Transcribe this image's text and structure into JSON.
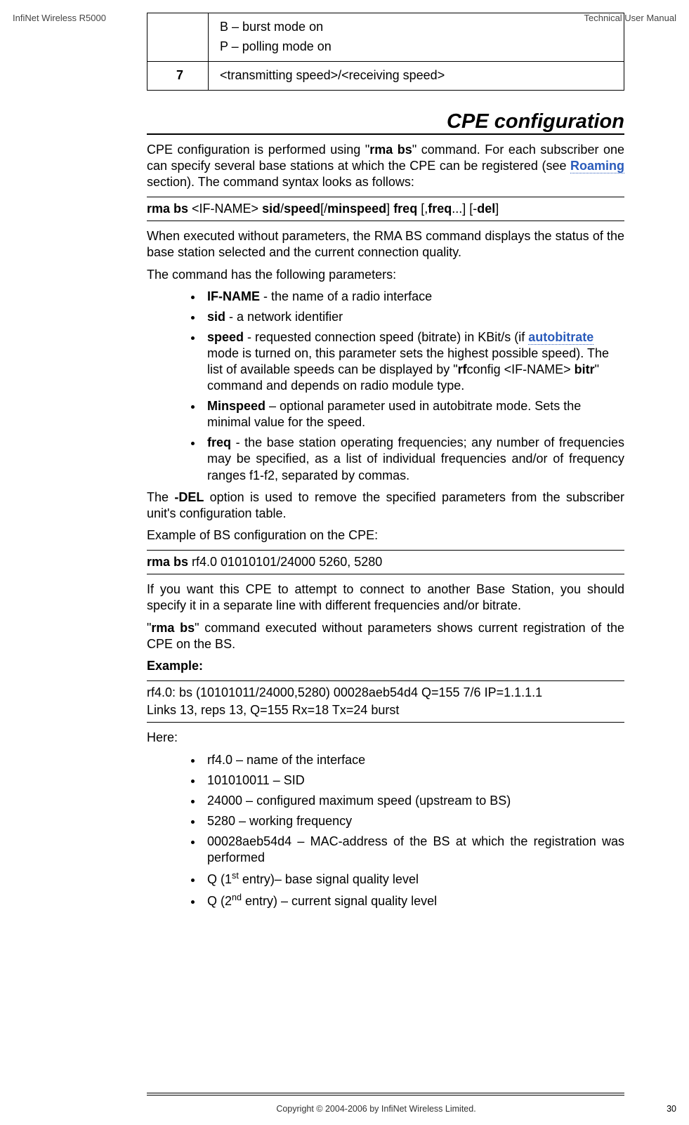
{
  "header": {
    "left": "InfiNet Wireless R5000",
    "right": "Technical User Manual"
  },
  "footer": {
    "copyright": "Copyright © 2004-2006 by InfiNet Wireless Limited.",
    "page": "30"
  },
  "table": {
    "row0_text1": "B – burst mode on",
    "row0_text2": "P – polling mode on",
    "row1_col0": "7",
    "row1_text": "<transmitting speed>/<receiving speed>"
  },
  "section_title": "CPE configuration",
  "p1a": "CPE configuration is performed using \"",
  "p1b": "rma bs",
  "p1c": "\" command. For each subscriber one can specify several base stations at which the CPE can be registered (see ",
  "p1d": "Roaming",
  "p1e": " section). The command syntax looks as follows:",
  "cmd1": {
    "a": "rma bs ",
    "b": "<IF-NAME> ",
    "c": "sid",
    "d": "/",
    "e": "speed",
    "f": "[/",
    "g": "minspeed",
    "h": "] ",
    "i": "freq ",
    "j": "[,",
    "k": "freq",
    "l": "...] [-",
    "m": "del",
    "n": "]"
  },
  "p2": "When executed without parameters, the RMA BS command displays the status of the base station selected and the current connection quality.",
  "p3": "The command has the following parameters:",
  "bullets1": {
    "b1a": "IF-NAME",
    "b1b": " - the name of a radio interface",
    "b2a": "sid",
    "b2b": " - a network identifier",
    "b3a": "speed",
    "b3b": " - requested connection speed (bitrate) in KBit/s (if ",
    "b3c": "autobitrate",
    "b3d": " mode is turned on, this parameter sets the highest possible speed). The list of available speeds can be displayed by \"",
    "b3e": "rf",
    "b3f": "config <IF-NAME> ",
    "b3g": "bitr",
    "b3h": "\" command and depends on radio module type.",
    "b4a": "Minspeed",
    "b4b": " – optional parameter used in autobitrate mode. Sets the minimal value for the speed.",
    "b5a": "freq",
    "b5b": " - the base station operating frequencies; any number of frequencies may be specified, as a list of individual frequencies and/or of frequency ranges f1-f2, separated by commas."
  },
  "p4a": "The ",
  "p4b": "-DEL",
  "p4c": " option is used to remove the specified parameters from the subscriber unit's configuration table.",
  "p5": "Example of BS configuration on the CPE:",
  "cmd2a": "rma bs ",
  "cmd2b": "rf4.0 01010101/24000 5260, 5280",
  "p6": "If you want this CPE to attempt to connect to another Base Station, you should specify it in a separate line with different frequencies and/or bitrate.",
  "p7a": "\"",
  "p7b": "rma bs",
  "p7c": "\" command executed without parameters shows current registration of the CPE on the BS.",
  "p8": "Example:",
  "cmd3_line1": "rf4.0: bs (10101011/24000,5280) 00028aeb54d4   Q=155  7/6  IP=1.1.1.1",
  "cmd3_line2": "Links 13, reps 13, Q=155 Rx=18 Tx=24  burst",
  "p9": "Here:",
  "bullets2": {
    "i1": "rf4.0 – name of the interface",
    "i2": "101010011 – SID",
    "i3": "24000 – configured maximum speed (upstream to BS)",
    "i4": "5280 – working frequency",
    "i5": "00028aeb54d4 – MAC-address of the BS at which the registration was performed",
    "i6a": "Q (1",
    "i6b": "st",
    "i6c": " entry)– base signal quality level",
    "i7a": "Q (2",
    "i7b": "nd",
    "i7c": " entry) – current signal quality level"
  }
}
